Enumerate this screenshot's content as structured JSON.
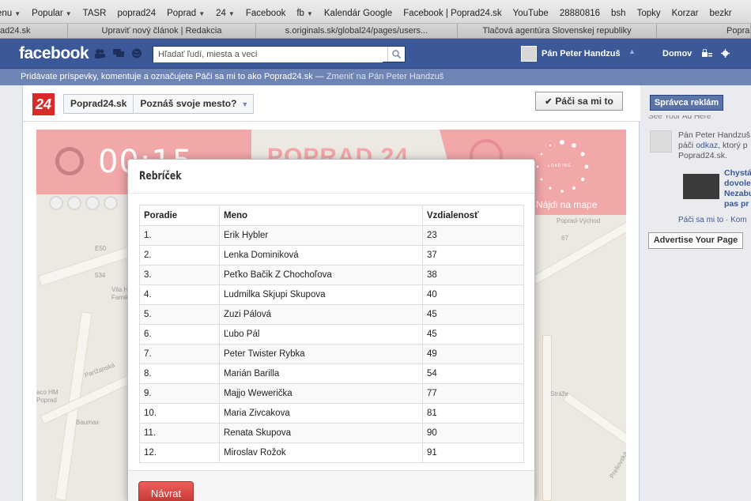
{
  "browser": {
    "bookmarks": [
      {
        "label": "enu",
        "dropdown": true
      },
      {
        "label": "Popular",
        "dropdown": true
      },
      {
        "label": "TASR",
        "dropdown": false
      },
      {
        "label": "poprad24",
        "dropdown": false
      },
      {
        "label": "Poprad",
        "dropdown": true
      },
      {
        "label": "24",
        "dropdown": true
      },
      {
        "label": "Facebook",
        "dropdown": false
      },
      {
        "label": "fb",
        "dropdown": true
      },
      {
        "label": "Kalendár Google",
        "dropdown": false
      },
      {
        "label": "Facebook | Poprad24.sk",
        "dropdown": false
      },
      {
        "label": "YouTube",
        "dropdown": false
      },
      {
        "label": "28880816",
        "dropdown": false
      },
      {
        "label": "bsh",
        "dropdown": false
      },
      {
        "label": "Topky",
        "dropdown": false
      },
      {
        "label": "Korzar",
        "dropdown": false
      },
      {
        "label": "bezkr",
        "dropdown": false
      }
    ],
    "tabs": [
      {
        "label": "ad24.sk"
      },
      {
        "label": "Upraviť nový článok | Redakcia"
      },
      {
        "label": "s.originals.sk/global24/pages/users..."
      },
      {
        "label": "Tlačová agentúra Slovenskej republiky"
      },
      {
        "label": "Popra"
      }
    ]
  },
  "facebook": {
    "logo": "facebook",
    "search_placeholder": "Hľadať ľudí, miesta a veci",
    "profile_name": "Pán Peter Handzuš",
    "home": "Domov",
    "notice_text": "Pridávate príspevky, komentuje a označujete Páči sa mi to ako Poprad24.sk — ",
    "notice_link": "Zmeniť na Pán Peter Handzuš",
    "brand_color": "#3b5998"
  },
  "app": {
    "logo": "24",
    "page_name": "Poprad24.sk",
    "tab_name": "Poznáš svoje mesto?",
    "like_label": "Páči sa mi to",
    "timer": "00:15",
    "brand": "POPRAD 24",
    "map_link": "Nájdi na mape",
    "loading_text": "LOADING",
    "map_labels": [
      "E50",
      "534",
      "Vila H",
      "Famé",
      "Poprad-Východ",
      "67",
      "Parížanská",
      "aco HM",
      "Poprad",
      "Baumax",
      "Stráže",
      "Prešovská"
    ]
  },
  "modal": {
    "title": "Rebríček",
    "headers": [
      "Poradie",
      "Meno",
      "Vzdialenosť"
    ],
    "rows": [
      [
        "1.",
        "Erik Hybler",
        "23"
      ],
      [
        "2.",
        "Lenka Dominiková",
        "37"
      ],
      [
        "3.",
        "Peťko Bačik Z Chochoľova",
        "38"
      ],
      [
        "4.",
        "Ludmilka Skjupi Skupova",
        "40"
      ],
      [
        "5.",
        "Zuzi Pálová",
        "45"
      ],
      [
        "6.",
        "Ľubo Pál",
        "45"
      ],
      [
        "7.",
        "Peter Twister Rybka",
        "49"
      ],
      [
        "8.",
        "Marián Barilla",
        "54"
      ],
      [
        "9.",
        "Majjo Wewerička",
        "77"
      ],
      [
        "10.",
        "Maria Zivcakova",
        "81"
      ],
      [
        "11.",
        "Renata Skupova",
        "90"
      ],
      [
        "12.",
        "Miroslav Rožok",
        "91"
      ]
    ],
    "back_button": "Návrat",
    "button_color": "#d9534f"
  },
  "sidebar": {
    "ads_button": "Správca reklám",
    "cut_text": "See Your Ad Here",
    "feed_name": "Pán Peter Handzuš",
    "feed_verb": " páči ",
    "feed_obj": "odkaz",
    "feed_rest": ", ktorý p",
    "feed_page": "Poprad24.sk.",
    "feed_title_lines": [
      "Chystá",
      "dovole",
      "Nezabu",
      "pas pr"
    ],
    "feed_actions": "Páči sa mi to · Kom",
    "advertise_button": "Advertise Your Page"
  }
}
